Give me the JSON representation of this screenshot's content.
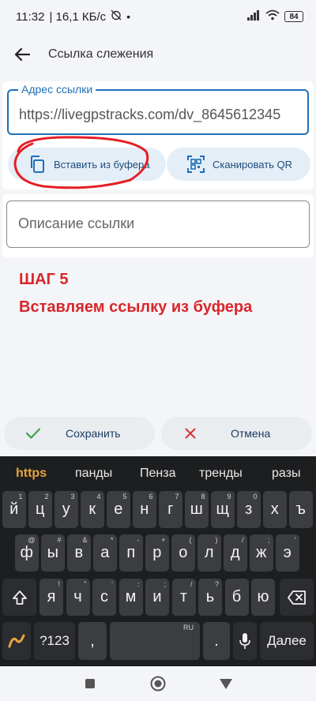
{
  "status": {
    "time": "11:32",
    "speed": "| 16,1 КБ/с",
    "battery": "84"
  },
  "appbar": {
    "title": "Ссылка слежения"
  },
  "link": {
    "label": "Адрес ссылки",
    "value": "https://livegpstracks.com/dv_8645612345",
    "paste_label": "Вставить из буфера",
    "scan_label": "Сканировать QR"
  },
  "description": {
    "placeholder": "Описание ссылки"
  },
  "annotation": {
    "step": "ШАГ 5",
    "text": "Вставляем ссылку из буфера",
    "color": "#d8262a"
  },
  "actions": {
    "save_label": "Сохранить",
    "cancel_label": "Отмена"
  },
  "keyboard": {
    "suggestions": [
      "https",
      "панды",
      "Пенза",
      "тренды",
      "разы"
    ],
    "row1": [
      {
        "k": "й",
        "h": "1"
      },
      {
        "k": "ц",
        "h": "2"
      },
      {
        "k": "у",
        "h": "3"
      },
      {
        "k": "к",
        "h": "4"
      },
      {
        "k": "е",
        "h": "5"
      },
      {
        "k": "н",
        "h": "6"
      },
      {
        "k": "г",
        "h": "7"
      },
      {
        "k": "ш",
        "h": "8"
      },
      {
        "k": "щ",
        "h": "9"
      },
      {
        "k": "з",
        "h": "0"
      },
      {
        "k": "х",
        "h": ""
      },
      {
        "k": "ъ",
        "h": ""
      }
    ],
    "row2": [
      {
        "k": "ф",
        "h": "@"
      },
      {
        "k": "ы",
        "h": "#"
      },
      {
        "k": "в",
        "h": "&"
      },
      {
        "k": "а",
        "h": "*"
      },
      {
        "k": "п",
        "h": "-"
      },
      {
        "k": "р",
        "h": "+"
      },
      {
        "k": "о",
        "h": "("
      },
      {
        "k": "л",
        "h": ")"
      },
      {
        "k": "д",
        "h": "/"
      },
      {
        "k": "ж",
        "h": ";"
      },
      {
        "k": "э",
        "h": "'"
      }
    ],
    "row3": [
      {
        "k": "я",
        "h": "!"
      },
      {
        "k": "ч",
        "h": "\""
      },
      {
        "k": "с",
        "h": "'"
      },
      {
        "k": "м",
        "h": ":"
      },
      {
        "k": "и",
        "h": ";"
      },
      {
        "k": "т",
        "h": "/"
      },
      {
        "k": "ь",
        "h": "?"
      },
      {
        "k": "б",
        "h": ""
      },
      {
        "k": "ю",
        "h": ""
      }
    ],
    "sym_label": "?123",
    "comma": ",",
    "comma_hint": "",
    "space_hint": "RU",
    "period": ".",
    "period_hint": "",
    "enter_label": "Далее"
  }
}
